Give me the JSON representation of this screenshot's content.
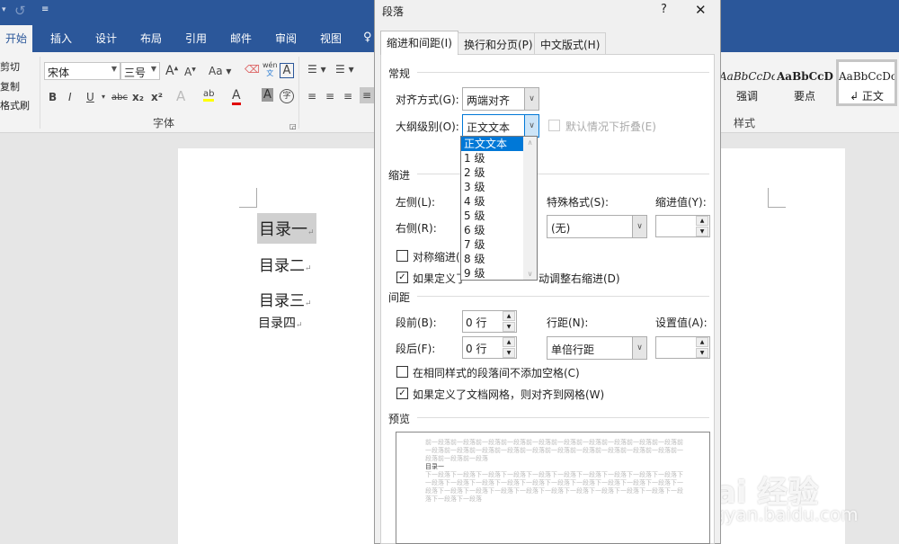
{
  "quick_access": {
    "redo_icon": "redo-icon",
    "customize_icon": "chevron-down-icon"
  },
  "ribbon_tabs": [
    "开始",
    "插入",
    "设计",
    "布局",
    "引用",
    "邮件",
    "审阅",
    "视图"
  ],
  "tell_me_icon": "lightbulb-icon",
  "clipboard": {
    "cut": "剪切",
    "copy": "复制",
    "format_painter": "格式刷"
  },
  "font": {
    "name": "宋体",
    "size": "三号",
    "group_label": "字体",
    "case_label": "Aa",
    "phonetic_top": "wén",
    "phonetic_bottom": "文",
    "bold": "B",
    "italic": "I",
    "underline": "U",
    "strike": "abc",
    "subscript": "x₂",
    "superscript": "x²",
    "highlight_color": "#ffff00",
    "font_color": "#e00000"
  },
  "styles": {
    "items": [
      {
        "preview": "AaBbCcDc",
        "label": "强调"
      },
      {
        "preview": "AaBbCcD",
        "label": "要点"
      },
      {
        "preview": "AaBbCcDc",
        "label": "↲ 正文"
      }
    ],
    "group_label": "样式"
  },
  "document": {
    "lines": [
      "目录一",
      "目录二",
      "目录三",
      "目录四"
    ],
    "para_mark": "↵"
  },
  "dialog": {
    "title": "段落",
    "help": "?",
    "close": "✕",
    "tabs": [
      "缩进和间距(I)",
      "换行和分页(P)",
      "中文版式(H)"
    ],
    "general": {
      "heading": "常规",
      "alignment_label": "对齐方式(G):",
      "alignment_value": "两端对齐",
      "outline_label": "大纲级别(O):",
      "outline_value": "正文文本",
      "collapse_label": "默认情况下折叠(E)"
    },
    "outline_options": [
      "正文文本",
      "1 级",
      "2 级",
      "3 级",
      "4 级",
      "5 级",
      "6 级",
      "7 级",
      "8 级",
      "9 级"
    ],
    "indent": {
      "heading": "缩进",
      "left_label": "左侧(L):",
      "right_label": "右侧(R):",
      "special_label": "特殊格式(S):",
      "special_value": "(无)",
      "by_label": "缩进值(Y):",
      "mirror_label": "对称缩进(M)",
      "auto_adjust_label_a": "如果定义了",
      "auto_adjust_label_b": "动调整右缩进(D)",
      "auto_adjust_checked": true,
      "mirror_checked": false
    },
    "spacing": {
      "heading": "间距",
      "before_label": "段前(B):",
      "before_value": "0 行",
      "after_label": "段后(F):",
      "after_value": "0 行",
      "line_label": "行距(N):",
      "line_value": "单倍行距",
      "at_label": "设置值(A):",
      "no_space_label": "在相同样式的段落间不添加空格(C)",
      "no_space_checked": false,
      "grid_label": "如果定义了文档网格，则对齐到网格(W)",
      "grid_checked": true
    },
    "preview": {
      "heading": "预览",
      "before_text": "前一段落前一段落前一段落前一段落前一段落前一段落前一段落前一段落前一段落前一段落前一段落前一段落前一段落前一段落前一段落前一段落前一段落前一段落前一段落前一段落前一段落前一段落前一段落",
      "sample": "目录一",
      "after_text": "下一段落下一段落下一段落下一段落下一段落下一段落下一段落下一段落下一段落下一段落下一段落下一段落下一段落下一段落下一段落下一段落下一段落下一段落下一段落下一段落下一段落下一段落下一段落下一段落下一段落下一段落下一段落下一段落下一段落下一段落下一段落下一段落下一段落"
    }
  },
  "watermark": {
    "brand": "Bai 经验",
    "url": "jingyan.baidu.com"
  }
}
